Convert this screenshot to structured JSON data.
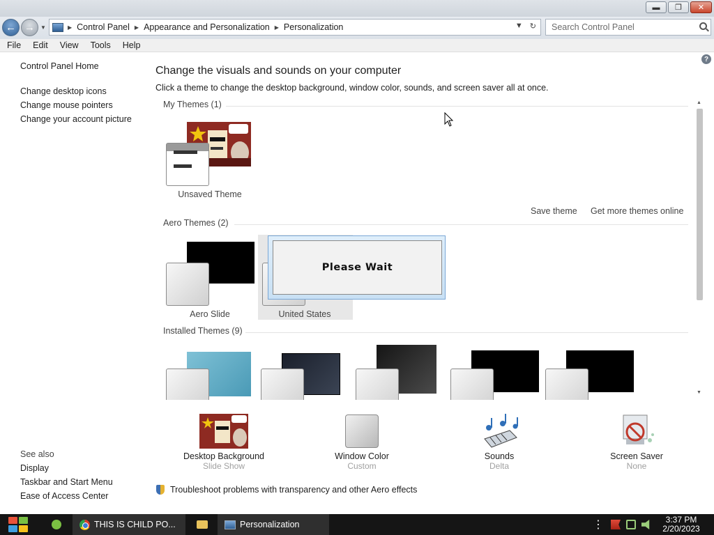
{
  "window": {
    "buttons": [
      "minimize",
      "maximize",
      "close"
    ]
  },
  "address": {
    "breadcrumbs": [
      "Control Panel",
      "Appearance and Personalization",
      "Personalization"
    ],
    "search_placeholder": "Search Control Panel"
  },
  "menu": [
    "File",
    "Edit",
    "View",
    "Tools",
    "Help"
  ],
  "sidebar": {
    "home": "Control Panel Home",
    "tasks": [
      "Change desktop icons",
      "Change mouse pointers",
      "Change your account picture"
    ],
    "see_also_title": "See also",
    "see_also": [
      "Display",
      "Taskbar and Start Menu",
      "Ease of Access Center"
    ]
  },
  "main": {
    "title": "Change the visuals and sounds on your computer",
    "subtitle": "Click a theme to change the desktop background, window color, sounds, and screen saver all at once.",
    "my_themes": {
      "label": "My Themes (1)",
      "items": [
        "Unsaved Theme"
      ]
    },
    "save_theme": "Save theme",
    "get_more": "Get more themes online",
    "aero_themes": {
      "label": "Aero Themes (2)",
      "items": [
        "Aero Slide",
        "United States"
      ]
    },
    "installed_themes": {
      "label": "Installed Themes (9)"
    },
    "dialog": "Please Wait"
  },
  "bottom": {
    "items": [
      {
        "label": "Desktop Background",
        "sub": "Slide Show"
      },
      {
        "label": "Window Color",
        "sub": "Custom"
      },
      {
        "label": "Sounds",
        "sub": "Delta"
      },
      {
        "label": "Screen Saver",
        "sub": "None"
      }
    ],
    "troubleshoot": "Troubleshoot problems with transparency and other Aero effects"
  },
  "taskbar": {
    "apps": [
      "THIS IS CHILD PO...",
      "Personalization"
    ],
    "time": "3:37 PM",
    "date": "2/20/2023"
  },
  "colors": {
    "accent": "#2f5f94",
    "taskbar": "#151515"
  }
}
